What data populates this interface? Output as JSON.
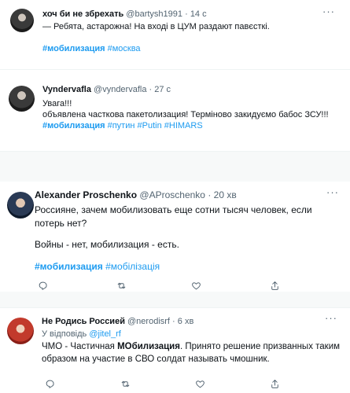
{
  "tweets": [
    {
      "name": "хоч би не збрехать",
      "handle": "@bartysh1991",
      "time": "14 с",
      "text": "— Ребята, астарожна! На вході в ЦУМ раздают павєсткі.",
      "tags": [
        "#мобилизация",
        "#москва"
      ]
    },
    {
      "name": "Vyndervafla",
      "handle": "@vyndervafla",
      "time": "27 с",
      "lines": [
        "Увага!!!",
        "объявлена часткова пакетолизация! Терміново закидуємо бабос ЗСУ!!!"
      ],
      "tags": [
        "#мобилизация",
        "#путин",
        "#Putin",
        "#HIMARS"
      ]
    },
    {
      "name": "Alexander Proschenko",
      "handle": "@AProschenko",
      "time": "20 хв",
      "text1": "Россияне, зачем мобилизовать еще сотни тысяч человек, если потерь нет?",
      "text2": "Войны - нет, мобилизация - есть.",
      "tags": [
        "#мобилизация",
        "#мобілізація"
      ]
    },
    {
      "name": "Не Родись Россией",
      "handle": "@nerodisrf",
      "time": "6 хв",
      "reply_prefix": "У відповідь",
      "reply_handle": "@jitel_rf",
      "text_a": "ЧМО - Частичная ",
      "text_b": "МОбилизация",
      "text_c": ". Принято решение призванных таким образом на участие в СВО солдат называть чмошник."
    }
  ],
  "separator": "·",
  "more_glyph": "···"
}
